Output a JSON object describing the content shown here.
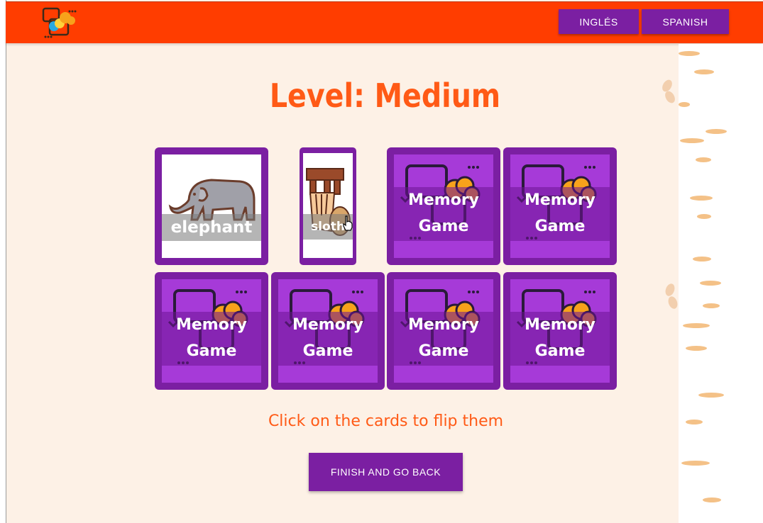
{
  "header": {
    "logo_icon": "memory-game-logo-icon",
    "buttons": [
      {
        "label": "INGLÉS"
      },
      {
        "label": "SPANISH"
      }
    ]
  },
  "main": {
    "title": "Level: Medium",
    "hint": "Click on the cards to flip them",
    "finish_label": "FINISH AND GO BACK"
  },
  "cards": {
    "face_up": [
      {
        "label": "elephant",
        "icon": "elephant-icon"
      },
      {
        "label": "sloth",
        "icon": "sloth-icon"
      }
    ],
    "back_line1": "Memory",
    "back_line2": "Game"
  },
  "colors": {
    "header": "#ff3d00",
    "accent": "#7b1fa2",
    "card_back": "#a63ad8",
    "title": "#ff5a16",
    "background": "#fdf1e6"
  }
}
